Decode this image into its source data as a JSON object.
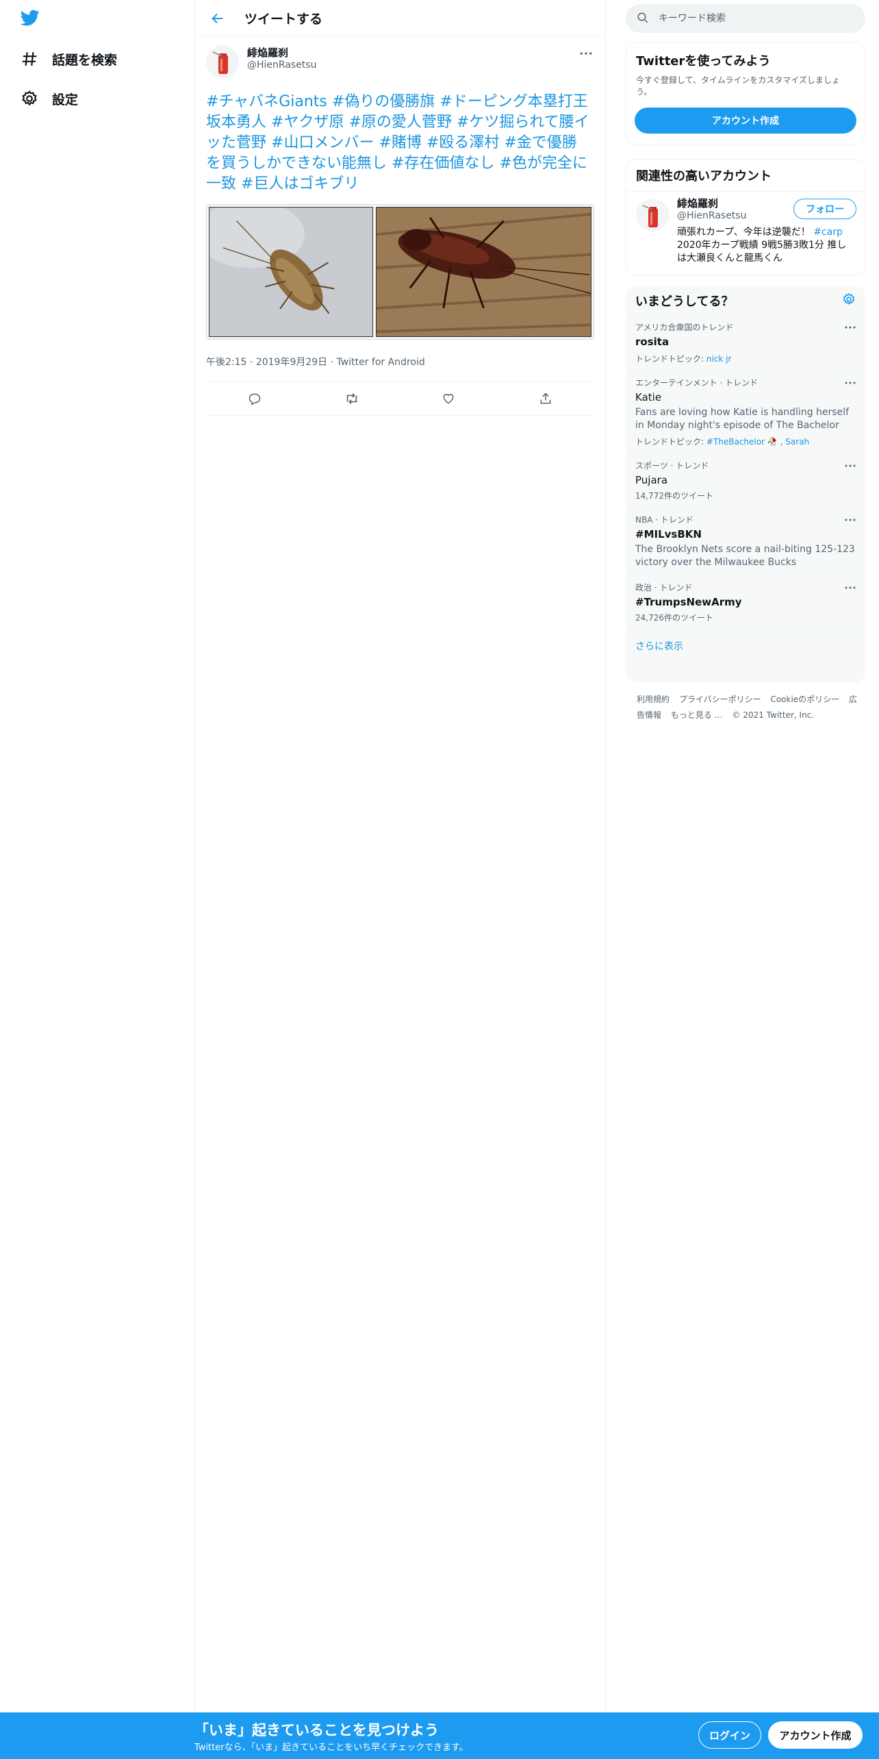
{
  "app": {
    "brand_color": "#1d9bf0",
    "link_color": "#1b95e0"
  },
  "nav": {
    "logo_icon": "twitter-bird-icon",
    "items": [
      {
        "icon": "hashtag-icon",
        "label": "話題を検索"
      },
      {
        "icon": "gear-icon",
        "label": "設定"
      }
    ]
  },
  "header": {
    "back_icon": "arrow-left-icon",
    "title": "ツイートする"
  },
  "tweet": {
    "author": {
      "name": "緋焔羅刹",
      "handle": "@HienRasetsu"
    },
    "more_icon": "more-horizontal-icon",
    "hashtags": [
      "#チャバネGiants",
      "#偽りの優勝旗",
      "#ドーピング本塁打王坂本勇人",
      "#ヤクザ原",
      "#原の愛人菅野",
      "#ケツ掘られて腰イッた菅野",
      "#山口メンバー",
      "#賭博",
      "#殴る澤村",
      "#金で優勝を買うしかできない能無し",
      "#存在価値なし",
      "#色が完全に一致",
      "#巨人はゴキブリ"
    ],
    "media": [
      {
        "alt": "german-cockroach-photo"
      },
      {
        "alt": "american-cockroach-photo"
      }
    ],
    "time": "午後2:15",
    "date": "2019年9月29日",
    "source": "Twitter for Android",
    "actions": [
      "reply-icon",
      "retweet-icon",
      "like-icon",
      "share-icon"
    ]
  },
  "sidebar": {
    "search": {
      "placeholder": "キーワード検索"
    },
    "signup": {
      "title": "Twitterを使ってみよう",
      "subtitle": "今すぐ登録して、タイムラインをカスタマイズしましょう。",
      "button": "アカウント作成"
    },
    "related": {
      "title": "関連性の高いアカウント",
      "name": "緋焔羅刹",
      "handle": "@HienRasetsu",
      "bio_prefix": "頑張れカープ、今年は逆襲だ！",
      "bio_tag": "#carp",
      "bio_rest": "2020年カープ戦績 9戦5勝3敗1分 推しは大瀬良くんと龍馬くん",
      "follow": "フォロー"
    },
    "trends": {
      "title": "いまどうしてる？",
      "items": [
        {
          "meta": "アメリカ合衆国のトレンド",
          "name": "rosita",
          "topics_label": "トレンドトピック:",
          "topics": "nick jr"
        },
        {
          "meta": "エンターテインメント · トレンド",
          "name": "Katie",
          "desc": "Fans are loving how Katie is handling herself in Monday night's episode of The Bachelor",
          "topics_label": "トレンドトピック:",
          "topics": "#TheBachelor",
          "topics2": "Sarah"
        },
        {
          "meta": "スポーツ · トレンド",
          "name": "Pujara",
          "count": "14,772件のツイート"
        },
        {
          "meta": "NBA · トレンド",
          "name": "#MILvsBKN",
          "desc": "The Brooklyn Nets score a nail-biting 125-123 victory over the Milwaukee Bucks"
        },
        {
          "meta": "政治 · トレンド",
          "name": "#TrumpsNewArmy",
          "count": "24,726件のツイート"
        }
      ],
      "show_more": "さらに表示"
    },
    "footer": {
      "links": [
        "利用規約",
        "プライバシーポリシー",
        "Cookieのポリシー",
        "広告情報",
        "もっと見る …"
      ],
      "copyright": "© 2021 Twitter, Inc."
    }
  },
  "bottom_bar": {
    "title": "「いま」起きていることを見つけよう",
    "subtitle": "Twitterなら、「いま」起きていることをいち早くチェックできます。",
    "login": "ログイン",
    "signup": "アカウント作成"
  }
}
